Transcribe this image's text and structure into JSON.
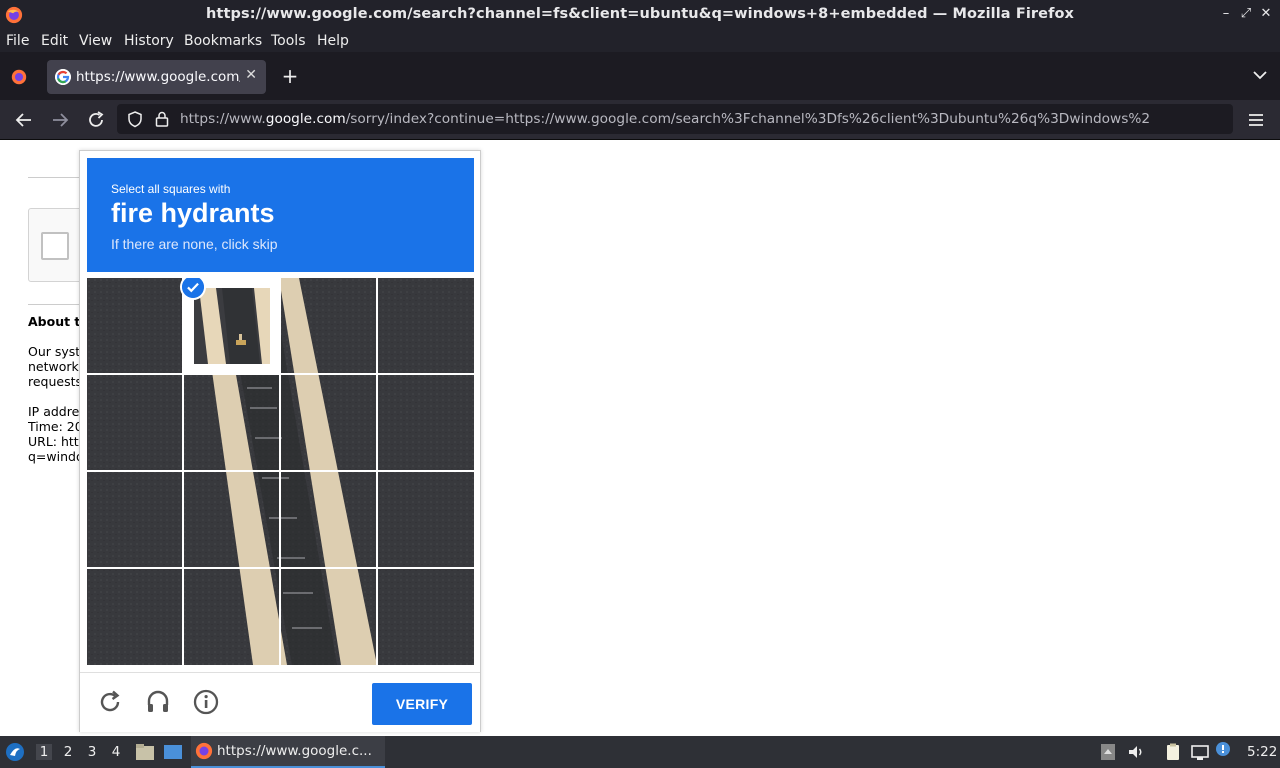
{
  "window": {
    "title": "https://www.google.com/search?channel=fs&client=ubuntu&q=windows+8+embedded — Mozilla Firefox",
    "controls": [
      "minimize",
      "maximize",
      "close"
    ]
  },
  "menubar": {
    "items": [
      {
        "label": "File",
        "key": "F"
      },
      {
        "label": "Edit",
        "key": "E"
      },
      {
        "label": "View",
        "key": "V"
      },
      {
        "label": "History",
        "key": "s"
      },
      {
        "label": "Bookmarks",
        "key": "B"
      },
      {
        "label": "Tools",
        "key": "T"
      },
      {
        "label": "Help",
        "key": "H"
      }
    ]
  },
  "tab": {
    "label": "https://www.google.com/",
    "favicon": "google-g-icon"
  },
  "urlbar": {
    "prefix": "https://www.",
    "domain": "google.com",
    "rest": "/sorry/index?continue=https://www.google.com/search%3Fchannel%3Dfs%26client%3Dubuntu%26q%3Dwindows%2"
  },
  "page": {
    "about_heading": "About th",
    "lines": [
      "Our syste",
      "network.",
      "requests",
      "IP addres",
      "Time: 20",
      "URL: http",
      "q=windo"
    ]
  },
  "captcha": {
    "instruction": "Select all squares with",
    "target": "fire hydrants",
    "hint": "If there are none, click skip",
    "grid_size": 4,
    "selected_tiles": [
      1
    ],
    "verify_label": "VERIFY",
    "footer_icons": [
      "reload-icon",
      "audio-challenge-icon",
      "info-icon"
    ],
    "accent": "#1a73e8"
  },
  "taskbar": {
    "workspaces": [
      "1",
      "2",
      "3",
      "4"
    ],
    "active_workspace": "1",
    "task_label": "https://www.google.c...",
    "clock": "5:22"
  }
}
